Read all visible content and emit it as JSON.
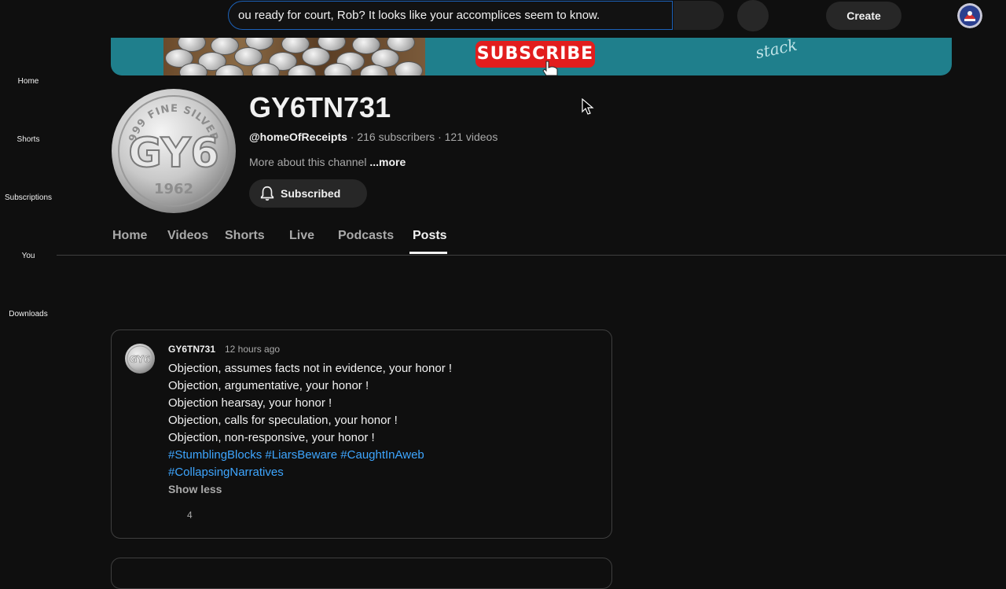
{
  "topbar": {
    "search_value": "ou ready for court, Rob? It looks like your accomplices seem to know.",
    "create_label": "Create"
  },
  "sidebar": {
    "items": [
      {
        "label": "Home"
      },
      {
        "label": "Shorts"
      },
      {
        "label": "Subscriptions"
      },
      {
        "label": "You"
      },
      {
        "label": "Downloads"
      }
    ]
  },
  "banner": {
    "subscribe_text": "SUBSCRIBE",
    "script_text": "stack",
    "coin_text": "GY6",
    "coin_year": "1962"
  },
  "channel": {
    "title": "GY6TN731",
    "handle": "@homeOfReceipts",
    "stats": " · 216 subscribers · 121 videos",
    "about": "More about this channel",
    "more": "...more",
    "subscribed_label": "Subscribed",
    "avatar_ring_text": "999 FINE SILVER",
    "avatar_main": "GY6",
    "avatar_year": "1962"
  },
  "tabs": [
    {
      "label": "Home"
    },
    {
      "label": "Videos"
    },
    {
      "label": "Shorts"
    },
    {
      "label": "Live"
    },
    {
      "label": "Podcasts"
    },
    {
      "label": "Posts",
      "active": true
    }
  ],
  "post": {
    "author": "GY6TN731",
    "time": "12 hours ago",
    "lines": [
      "Objection, assumes facts not in evidence, your honor !",
      "Objection, argumentative, your honor !",
      "Objection hearsay, your honor !",
      "Objection, calls for speculation, your honor !",
      "Objection, non-responsive, your honor !"
    ],
    "hashtags_line1": [
      "#StumblingBlocks",
      "#LiarsBeware",
      "#CaughtInAweb"
    ],
    "hashtags_line2": [
      "#CollapsingNarratives"
    ],
    "show_less": "Show less",
    "likes": "4"
  },
  "colors": {
    "background": "#0f0f0f",
    "hashtag": "#3ea6ff",
    "banner": "#1f7f8c",
    "subscribe_red": "#e21d1d",
    "search_border": "#1c62b9"
  }
}
